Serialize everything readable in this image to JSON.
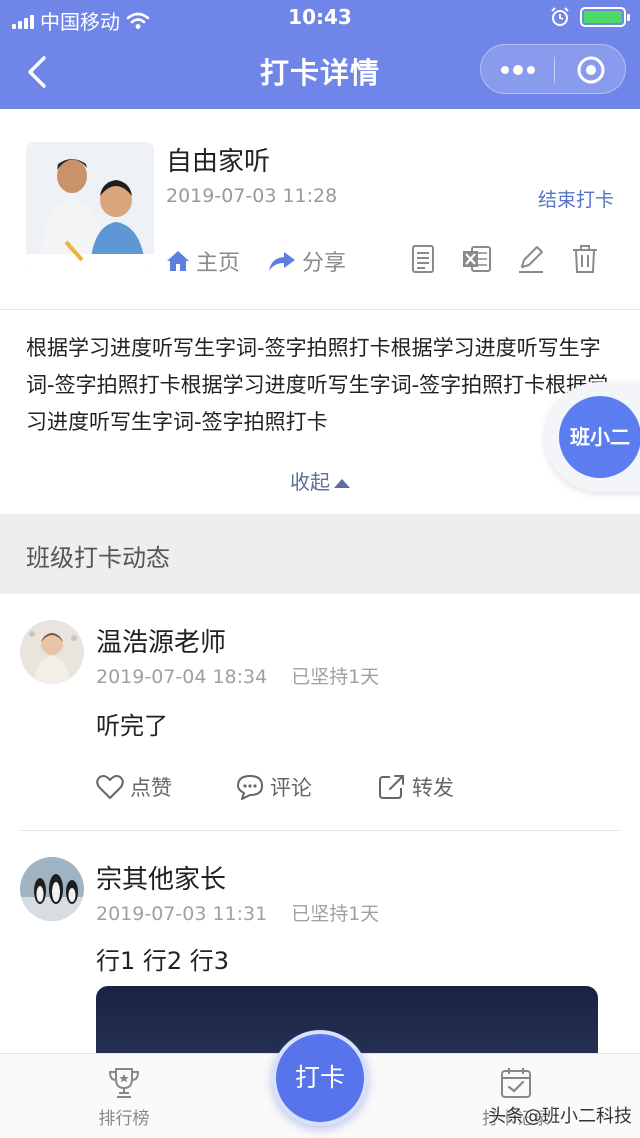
{
  "status_bar": {
    "carrier": "中国移动",
    "time": "10:43"
  },
  "nav": {
    "title": "打卡详情"
  },
  "card": {
    "title": "自由家听",
    "datetime": "2019-07-03 11:28",
    "end_label": "结束打卡",
    "home_label": "主页",
    "share_label": "分享"
  },
  "description": {
    "text": "根据学习进度听写生字词-签字拍照打卡根据学习进度听写生字词-签字拍照打卡根据学习进度听写生字词-签字拍照打卡根据学习进度听写生字词-签字拍照打卡",
    "collapse_label": "收起"
  },
  "float_badge": {
    "label": "班小二"
  },
  "section": {
    "title": "班级打卡动态"
  },
  "posts": [
    {
      "name": "温浩源老师",
      "datetime": "2019-07-04 18:34",
      "streak": "已坚持1天",
      "text": "听完了",
      "like_label": "点赞",
      "comment_label": "评论",
      "forward_label": "转发"
    },
    {
      "name": "宗其他家长",
      "datetime": "2019-07-03 11:31",
      "streak": "已坚持1天",
      "text": "行1 行2 行3"
    }
  ],
  "tabbar": {
    "ranking_label": "排行榜",
    "checkin_label": "打卡",
    "record_label": "打卡记录"
  },
  "watermark": "头条@班小二科技",
  "colors": {
    "header": "#6f86e8",
    "accent": "#5774ea",
    "link": "#5673c8"
  }
}
